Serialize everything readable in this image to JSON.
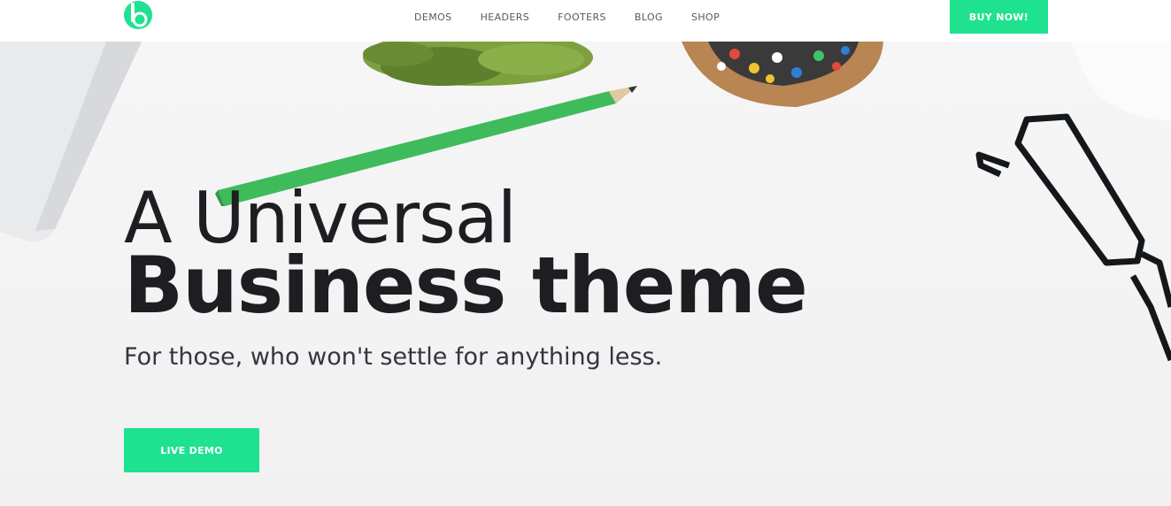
{
  "header": {
    "logo_icon": "b-logo-icon",
    "menu": [
      "DEMOS",
      "HEADERS",
      "FOOTERS",
      "BLOG",
      "SHOP"
    ],
    "buy_label": "BUY NOW!"
  },
  "hero": {
    "title_line1": "A Universal",
    "title_line2": "Business theme",
    "subtitle": "For those, who won't settle for anything less.",
    "cta_label": "LIVE DEMO"
  },
  "colors": {
    "accent": "#1ee28f",
    "text_dark": "#1d1d22",
    "nav_text": "#555a60",
    "background": "#f3f3f4"
  }
}
